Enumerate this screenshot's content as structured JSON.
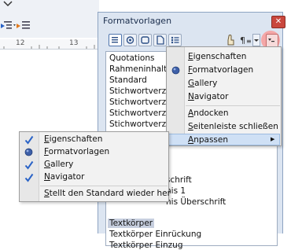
{
  "ruler": {
    "n1": "12",
    "n2": "13"
  },
  "dialog": {
    "title": "Formatvorlagen",
    "close_glyph": "✕"
  },
  "style_list": [
    "Quotations",
    "Rahmeninhalt",
    "Standard",
    "Stichwortverzeic",
    "Stichwortverzeic",
    "Stichwortverzeic",
    "Stichwortverzeic"
  ],
  "style_list_lower": [
    {
      "text": "schrift",
      "selected": false
    },
    {
      "text": "nis 1",
      "selected": false
    },
    {
      "text": "nis Überschrift",
      "selected": false
    },
    {
      "text": "",
      "selected": false
    },
    {
      "text": "Textkörper",
      "selected": true
    },
    {
      "text": "Textkörper Einrückung",
      "selected": false
    },
    {
      "text": "Textkörper Einzug",
      "selected": false
    }
  ],
  "deck_menu": {
    "items": [
      {
        "ul": "E",
        "rest": "igenschaften",
        "mark": ""
      },
      {
        "ul": "F",
        "rest": "ormatvorlagen",
        "mark": "dot"
      },
      {
        "ul": "G",
        "rest": "allery",
        "mark": ""
      },
      {
        "ul": "N",
        "rest": "avigator",
        "mark": ""
      }
    ],
    "dock": {
      "ul": "A",
      "rest": "ndocken"
    },
    "close": {
      "ul": "S",
      "rest": "eitenleiste schließen"
    },
    "customize": {
      "ul": "A",
      "rest": "npassen"
    },
    "submenu_arrow": "▶"
  },
  "customize_menu": {
    "items": [
      {
        "ul": "E",
        "rest": "igenschaften",
        "mark": "check"
      },
      {
        "ul": "F",
        "rest": "ormatvorlagen",
        "mark": "dot"
      },
      {
        "ul": "G",
        "rest": "allery",
        "mark": "check"
      },
      {
        "ul": "N",
        "rest": "avigator",
        "mark": "check"
      }
    ],
    "reset": {
      "ul": "S",
      "rest": "tellt den Standard wieder her"
    }
  },
  "colors": {
    "dialog_bg": "#dce5f1",
    "highlight": "#f4a7a7",
    "selection": "#c7cfdf",
    "check": "#2a63c7"
  }
}
